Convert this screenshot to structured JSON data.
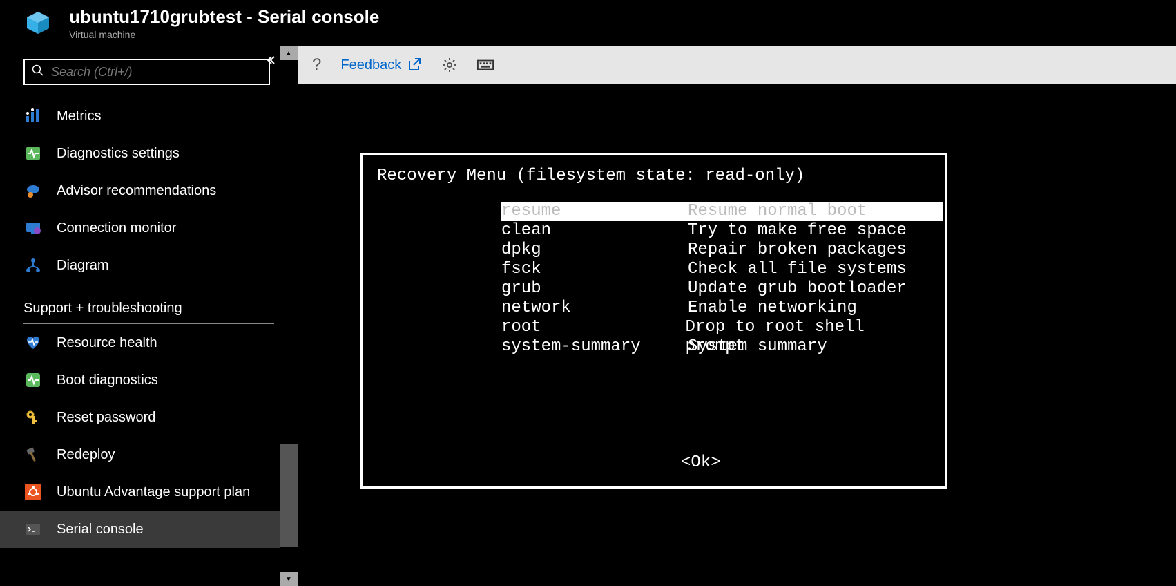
{
  "header": {
    "title": "ubuntu1710grubtest - Serial console",
    "subtitle": "Virtual machine"
  },
  "search": {
    "placeholder": "Search (Ctrl+/)"
  },
  "sidebar": {
    "items": [
      {
        "icon": "metrics",
        "label": "Metrics"
      },
      {
        "icon": "diag-settings",
        "label": "Diagnostics settings"
      },
      {
        "icon": "advisor",
        "label": "Advisor recommendations"
      },
      {
        "icon": "conn-monitor",
        "label": "Connection monitor"
      },
      {
        "icon": "diagram",
        "label": "Diagram"
      }
    ],
    "support_title": "Support + troubleshooting",
    "support_items": [
      {
        "icon": "heart",
        "label": "Resource health"
      },
      {
        "icon": "boot",
        "label": "Boot diagnostics"
      },
      {
        "icon": "key",
        "label": "Reset password"
      },
      {
        "icon": "hammer",
        "label": "Redeploy"
      },
      {
        "icon": "ubuntu",
        "label": "Ubuntu Advantage support plan"
      },
      {
        "icon": "console",
        "label": "Serial console"
      }
    ]
  },
  "toolbar": {
    "help": "?",
    "feedback": "Feedback"
  },
  "console": {
    "title": "Recovery Menu (filesystem state: read-only)",
    "menu": [
      {
        "key": "resume",
        "desc": "Resume normal boot",
        "selected": true
      },
      {
        "key": "clean",
        "desc": "Try to make free space"
      },
      {
        "key": "dpkg",
        "desc": "Repair broken packages"
      },
      {
        "key": "fsck",
        "desc": "Check all file systems"
      },
      {
        "key": "grub",
        "desc": "Update grub bootloader"
      },
      {
        "key": "network",
        "desc": "Enable networking"
      },
      {
        "key": "root",
        "desc": "Drop to root shell prompt"
      },
      {
        "key": "system-summary",
        "desc": "System summary"
      }
    ],
    "ok": "<Ok>"
  }
}
